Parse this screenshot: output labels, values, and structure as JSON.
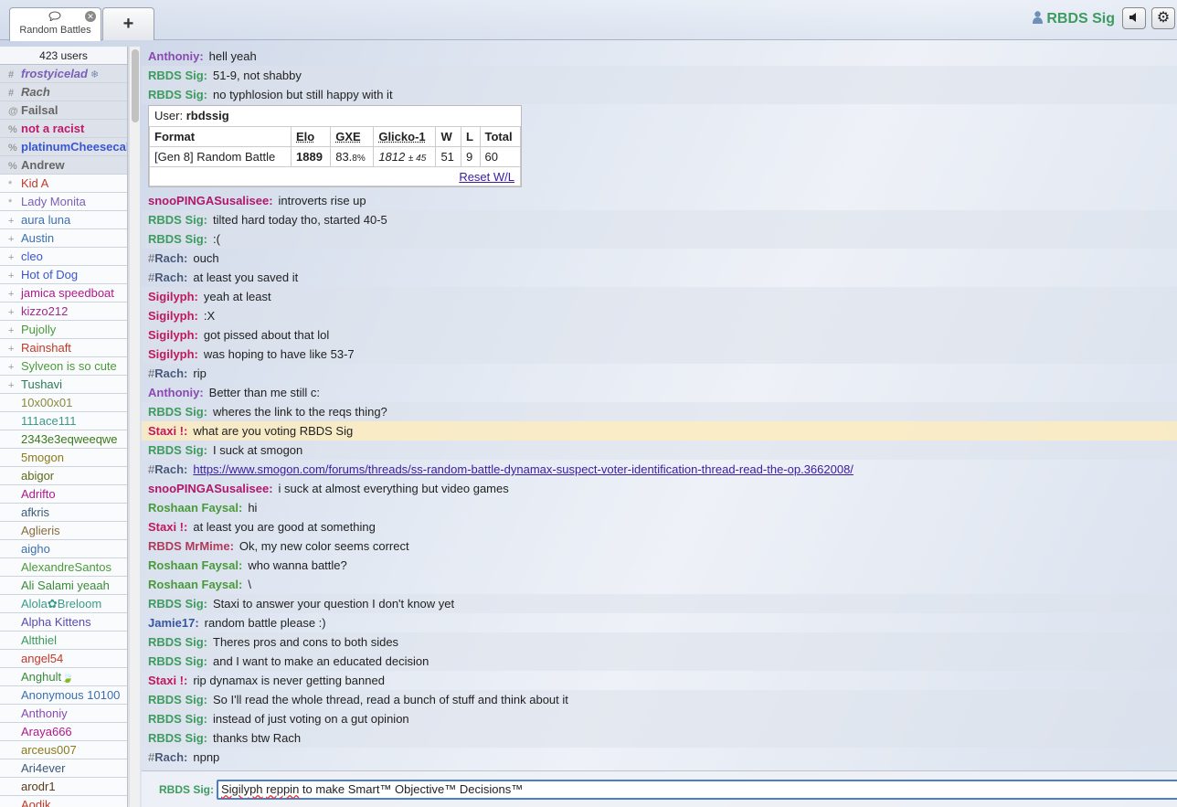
{
  "header": {
    "room_tab_label": "Random Battles",
    "add_tab_label": "+",
    "username": "RBDS Sig",
    "colors": {
      "username": "#3d9b5f",
      "accent": "#4a7ec7"
    }
  },
  "userlist": {
    "count": "423 users",
    "users": [
      {
        "rank": "#",
        "name": "frostyicelad",
        "suffix": " ❄",
        "color": "#7a5fb8",
        "style": "auth italic"
      },
      {
        "rank": "#",
        "name": "Rach",
        "suffix": "",
        "color": "#666666",
        "style": "auth italic"
      },
      {
        "rank": "@",
        "name": "Failsal",
        "suffix": "",
        "color": "#666666",
        "style": "auth"
      },
      {
        "rank": "%",
        "name": "not a racist",
        "suffix": "",
        "color": "#c0186b",
        "style": "auth"
      },
      {
        "rank": "%",
        "name": "platinumCheesecake",
        "suffix": "",
        "color": "#3a55d0",
        "style": "auth"
      },
      {
        "rank": "%",
        "name": "Andrew",
        "suffix": "",
        "color": "#666666",
        "style": "auth"
      },
      {
        "rank": "*",
        "name": "Kid A",
        "suffix": "",
        "color": "#c0392b",
        "style": ""
      },
      {
        "rank": "*",
        "name": "Lady Monita",
        "suffix": "",
        "color": "#7a5fb8",
        "style": ""
      },
      {
        "rank": "+",
        "name": "aura luna",
        "suffix": "",
        "color": "#3a6fb0",
        "style": ""
      },
      {
        "rank": "+",
        "name": "Austin",
        "suffix": "",
        "color": "#3a6fb0",
        "style": ""
      },
      {
        "rank": "+",
        "name": "cleo",
        "suffix": "",
        "color": "#3a55d0",
        "style": ""
      },
      {
        "rank": "+",
        "name": "Hot of Dog",
        "suffix": "",
        "color": "#3a55d0",
        "style": ""
      },
      {
        "rank": "+",
        "name": "jamica speedboat",
        "suffix": "",
        "color": "#b0188b",
        "style": ""
      },
      {
        "rank": "+",
        "name": "kizzo212",
        "suffix": "",
        "color": "#a02a8a",
        "style": ""
      },
      {
        "rank": "+",
        "name": "Pujolly",
        "suffix": "",
        "color": "#4a9a3a",
        "style": ""
      },
      {
        "rank": "+",
        "name": "Rainshaft",
        "suffix": "",
        "color": "#c0392b",
        "style": ""
      },
      {
        "rank": "+",
        "name": "Sylveon is so cute",
        "suffix": "",
        "color": "#4a9a3a",
        "style": ""
      },
      {
        "rank": "+",
        "name": "Tushavi",
        "suffix": "",
        "color": "#2a7a5a",
        "style": ""
      },
      {
        "rank": "",
        "name": "10x00x01",
        "suffix": "",
        "color": "#8a8a3a",
        "style": ""
      },
      {
        "rank": "",
        "name": "111ace111",
        "suffix": "",
        "color": "#3a9a8a",
        "style": ""
      },
      {
        "rank": "",
        "name": "2343e3eqweeqwe",
        "suffix": "",
        "color": "#3a7a1a",
        "style": ""
      },
      {
        "rank": "",
        "name": "5mogon",
        "suffix": "",
        "color": "#8a7a1a",
        "style": ""
      },
      {
        "rank": "",
        "name": "abigor",
        "suffix": "",
        "color": "#5a6a1a",
        "style": ""
      },
      {
        "rank": "",
        "name": "Adrifto",
        "suffix": "",
        "color": "#b0188b",
        "style": ""
      },
      {
        "rank": "",
        "name": "afkris",
        "suffix": "",
        "color": "#3a5a7a",
        "style": ""
      },
      {
        "rank": "",
        "name": "Aglieris",
        "suffix": "",
        "color": "#8a6a3a",
        "style": ""
      },
      {
        "rank": "",
        "name": "aigho",
        "suffix": "",
        "color": "#3a6fb0",
        "style": ""
      },
      {
        "rank": "",
        "name": "AlexandreSantos",
        "suffix": "",
        "color": "#4a9a3a",
        "style": ""
      },
      {
        "rank": "",
        "name": "Ali Salami yeaah",
        "suffix": "",
        "color": "#3a8a3a",
        "style": ""
      },
      {
        "rank": "",
        "name": "Alola✿Breloom",
        "suffix": "",
        "color": "#3a9a8a",
        "style": ""
      },
      {
        "rank": "",
        "name": "Alpha Kittens",
        "suffix": "",
        "color": "#5a4ab0",
        "style": ""
      },
      {
        "rank": "",
        "name": "Altthiel",
        "suffix": "",
        "color": "#3a9a5a",
        "style": ""
      },
      {
        "rank": "",
        "name": "angel54",
        "suffix": "",
        "color": "#c0392b",
        "style": ""
      },
      {
        "rank": "",
        "name": "Anghult",
        "suffix": "🍃",
        "color": "#3a8a3a",
        "style": ""
      },
      {
        "rank": "",
        "name": "Anonymous 10100",
        "suffix": "",
        "color": "#3a6fb0",
        "style": ""
      },
      {
        "rank": "",
        "name": "Anthoniy",
        "suffix": "",
        "color": "#8a4ab0",
        "style": ""
      },
      {
        "rank": "",
        "name": "Araya666",
        "suffix": "",
        "color": "#b0188b",
        "style": ""
      },
      {
        "rank": "",
        "name": "arceus007",
        "suffix": "",
        "color": "#8a7a1a",
        "style": ""
      },
      {
        "rank": "",
        "name": "Ari4ever",
        "suffix": "",
        "color": "#3a5a7a",
        "style": ""
      },
      {
        "rank": "",
        "name": "arodr1",
        "suffix": "",
        "color": "#5a3a1a",
        "style": ""
      },
      {
        "rank": "",
        "name": "Aodik",
        "suffix": "",
        "color": "#c0392b",
        "style": ""
      }
    ]
  },
  "chat": {
    "messages_before": [
      {
        "sym": "",
        "author": "Anthoniy:",
        "text": "hell yeah",
        "color": "#8a4ab0",
        "bg": ""
      },
      {
        "sym": "",
        "author": "RBDS Sig:",
        "text": "51-9, not shabby",
        "color": "#3d9b5f",
        "bg": "alt"
      },
      {
        "sym": "",
        "author": "RBDS Sig:",
        "text": "no typhlosion but still happy with it",
        "color": "#3d9b5f",
        "bg": "alt"
      }
    ],
    "rank_box": {
      "user_label": "User:",
      "user_value": "rbdssig",
      "headers": [
        "Format",
        "Elo",
        "GXE",
        "Glicko-1",
        "W",
        "L",
        "Total"
      ],
      "row": {
        "format": "[Gen 8] Random Battle",
        "elo": "1889",
        "gxe": "83.",
        "gxe_dec": "8%",
        "glicko": "1812",
        "glicko_dev": "± 45",
        "w": "51",
        "l": "9",
        "total": "60"
      },
      "reset_label": "Reset W/L"
    },
    "messages_after": [
      {
        "sym": "",
        "author": "snooPINGASusalisee:",
        "text": "introverts rise up",
        "color": "#b0186b",
        "bg": ""
      },
      {
        "sym": "",
        "author": "RBDS Sig:",
        "text": "tilted hard today tho, started 40-5",
        "color": "#3d9b5f",
        "bg": "alt"
      },
      {
        "sym": "",
        "author": "RBDS Sig:",
        "text": ":(",
        "color": "#3d9b5f",
        "bg": "alt"
      },
      {
        "sym": "#",
        "author": "Rach:",
        "text": "ouch",
        "color": "#4a5a7a",
        "bg": ""
      },
      {
        "sym": "#",
        "author": "Rach:",
        "text": "at least you saved it",
        "color": "#4a5a7a",
        "bg": ""
      },
      {
        "sym": "",
        "author": "Sigilyph:",
        "text": "yeah at least",
        "color": "#c0185b",
        "bg": "alt"
      },
      {
        "sym": "",
        "author": "Sigilyph:",
        "text": ":X",
        "color": "#c0185b",
        "bg": "alt"
      },
      {
        "sym": "",
        "author": "Sigilyph:",
        "text": "got pissed about that lol",
        "color": "#c0185b",
        "bg": "alt"
      },
      {
        "sym": "",
        "author": "Sigilyph:",
        "text": "was hoping to have like 53-7",
        "color": "#c0185b",
        "bg": "alt"
      },
      {
        "sym": "#",
        "author": "Rach:",
        "text": "rip",
        "color": "#4a5a7a",
        "bg": ""
      },
      {
        "sym": "",
        "author": "Anthoniy:",
        "text": "Better than me still c:",
        "color": "#8a4ab0",
        "bg": ""
      },
      {
        "sym": "",
        "author": "RBDS Sig:",
        "text": "wheres the link to the reqs thing?",
        "color": "#3d9b5f",
        "bg": "alt"
      },
      {
        "sym": "",
        "author": "Staxi !:",
        "text": "what are you voting RBDS Sig",
        "color": "#c0185b",
        "bg": "hl"
      },
      {
        "sym": "",
        "author": "RBDS Sig:",
        "text": "I suck at smogon",
        "color": "#3d9b5f",
        "bg": "alt"
      },
      {
        "sym": "#",
        "author": "Rach:",
        "text": "",
        "link": "https://www.smogon.com/forums/threads/ss-random-battle-dynamax-suspect-voter-identification-thread-read-the-op.3662008/",
        "color": "#4a5a7a",
        "bg": ""
      },
      {
        "sym": "",
        "author": "snooPINGASusalisee:",
        "text": "i suck at almost everything but video games",
        "color": "#b0186b",
        "bg": ""
      },
      {
        "sym": "",
        "author": "Roshaan Faysal:",
        "text": "hi",
        "color": "#4a9a3a",
        "bg": ""
      },
      {
        "sym": "",
        "author": "Staxi !:",
        "text": "at least you are good at something",
        "color": "#c0185b",
        "bg": ""
      },
      {
        "sym": "",
        "author": "RBDS MrMime:",
        "text": "Ok, my new color seems correct",
        "color": "#b03a5a",
        "bg": ""
      },
      {
        "sym": "",
        "author": "Roshaan Faysal:",
        "text": "who wanna battle?",
        "color": "#4a9a3a",
        "bg": ""
      },
      {
        "sym": "",
        "author": "Roshaan Faysal:",
        "text": "\\",
        "color": "#4a9a3a",
        "bg": ""
      },
      {
        "sym": "",
        "author": "RBDS Sig:",
        "text": "Staxi to answer your question I don't know yet",
        "color": "#3d9b5f",
        "bg": "alt"
      },
      {
        "sym": "",
        "author": "Jamie17:",
        "text": "random battle please :)",
        "color": "#3a55a0",
        "bg": ""
      },
      {
        "sym": "",
        "author": "RBDS Sig:",
        "text": "Theres pros and cons to both sides",
        "color": "#3d9b5f",
        "bg": "alt"
      },
      {
        "sym": "",
        "author": "RBDS Sig:",
        "text": "and I want to make an educated decision",
        "color": "#3d9b5f",
        "bg": "alt"
      },
      {
        "sym": "",
        "author": "Staxi !:",
        "text": "rip dynamax is never getting banned",
        "color": "#c0185b",
        "bg": ""
      },
      {
        "sym": "",
        "author": "RBDS Sig:",
        "text": "So I'll read the whole thread, read a bunch of stuff and think about it",
        "color": "#3d9b5f",
        "bg": "alt"
      },
      {
        "sym": "",
        "author": "RBDS Sig:",
        "text": "instead of just voting on a gut opinion",
        "color": "#3d9b5f",
        "bg": "alt"
      },
      {
        "sym": "",
        "author": "RBDS Sig:",
        "text": "thanks btw Rach",
        "color": "#3d9b5f",
        "bg": "alt"
      },
      {
        "sym": "#",
        "author": "Rach:",
        "text": "npnp",
        "color": "#4a5a7a",
        "bg": ""
      }
    ]
  },
  "chatbox": {
    "label": "RBDS Sig:",
    "value_word1": "Sigilyph",
    "value_word2": "reppin",
    "value_rest": " to make Smart™ Objective™ Decisions™"
  }
}
